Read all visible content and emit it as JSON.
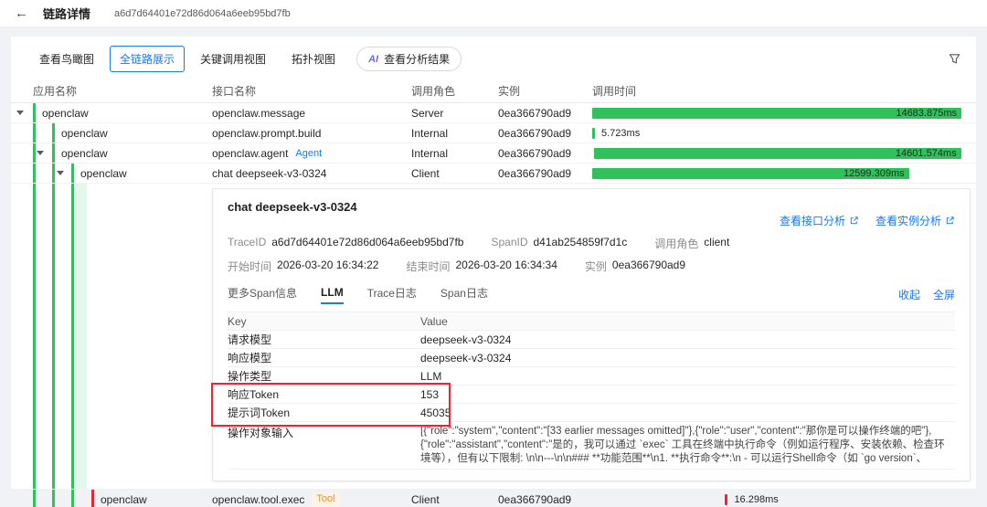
{
  "icons": {
    "back": "←",
    "ai": "AI",
    "external_link": "external-link",
    "filter": "funnel",
    "caret": "caret-down"
  },
  "colors": {
    "green": "#2fc25b",
    "red": "#f5222d",
    "blue": "#1677ff"
  },
  "page": {
    "title": "链路详情",
    "trace_id": "a6d7d64401e72d86d064a6eeb95bd7fb"
  },
  "toolbar": {
    "tabs": [
      {
        "label": "查看鸟瞰图"
      },
      {
        "label": "全链路展示"
      },
      {
        "label": "关键调用视图"
      },
      {
        "label": "拓扑视图"
      }
    ],
    "ai_button_label": "查看分析结果"
  },
  "table": {
    "columns": [
      "应用名称",
      "接口名称",
      "调用角色",
      "实例",
      "调用时间"
    ],
    "rows": [
      {
        "app": "openclaw",
        "interface": "openclaw.message",
        "tag": "",
        "role": "Server",
        "instance": "0ea366790ad9",
        "duration": "14683.875ms",
        "bar_width_pct": 100,
        "bar_offset_pct": 0,
        "bar_color": "#2fc25b"
      },
      {
        "app": "openclaw",
        "interface": "openclaw.prompt.build",
        "tag": "",
        "role": "Internal",
        "instance": "0ea366790ad9",
        "duration": "5.723ms",
        "bar_width_pct": 0.4,
        "bar_offset_pct": 0,
        "bar_color": "#2fc25b"
      },
      {
        "app": "openclaw",
        "interface": "openclaw.agent",
        "tag": "Agent",
        "role": "Internal",
        "instance": "0ea366790ad9",
        "duration": "14601.574ms",
        "bar_width_pct": 99.3,
        "bar_offset_pct": 0.6,
        "bar_color": "#2fc25b"
      },
      {
        "app": "openclaw",
        "interface": "chat deepseek-v3-0324",
        "tag": "",
        "role": "Client",
        "instance": "0ea366790ad9",
        "duration": "12599.309ms",
        "bar_width_pct": 85.8,
        "bar_offset_pct": 0,
        "bar_color": "#2fc25b"
      },
      {
        "app": "openclaw",
        "interface": "openclaw.tool.exec",
        "tag": "Tool",
        "role": "Client",
        "instance": "0ea366790ad9",
        "duration": "16.298ms",
        "bar_width_pct": 0.4,
        "bar_offset_pct": 36,
        "bar_color": "#f5222d"
      }
    ]
  },
  "detail": {
    "title": "chat deepseek-v3-0324",
    "links": [
      {
        "label": "查看接口分析"
      },
      {
        "label": "查看实例分析"
      }
    ],
    "meta_row1": [
      {
        "label": "TraceID",
        "value": "a6d7d64401e72d86d064a6eeb95bd7fb"
      },
      {
        "label": "SpanID",
        "value": "d41ab254859f7d1c"
      },
      {
        "label": "调用角色",
        "value": "client"
      }
    ],
    "meta_row2": [
      {
        "label": "开始时间",
        "value": "2026-03-20 16:34:22"
      },
      {
        "label": "结束时间",
        "value": "2026-03-20 16:34:34"
      },
      {
        "label": "实例",
        "value": "0ea366790ad9"
      }
    ],
    "tabs": [
      {
        "label": "更多Span信息"
      },
      {
        "label": "LLM"
      },
      {
        "label": "Trace日志"
      },
      {
        "label": "Span日志"
      }
    ],
    "actions": [
      {
        "label": "收起"
      },
      {
        "label": "全屏"
      }
    ],
    "kv": {
      "headers": [
        "Key",
        "Value"
      ],
      "rows": [
        {
          "key": "请求模型",
          "value": "deepseek-v3-0324"
        },
        {
          "key": "响应模型",
          "value": "deepseek-v3-0324"
        },
        {
          "key": "操作类型",
          "value": "LLM"
        },
        {
          "key": "响应Token",
          "value": "153"
        },
        {
          "key": "提示词Token",
          "value": "45035"
        },
        {
          "key": "操作对象输入",
          "value": "[{\"role\":\"system\",\"content\":\"[33 earlier messages omitted]\"},{\"role\":\"user\",\"content\":\"那你是可以操作终端的吧\"},{\"role\":\"assistant\",\"content\":\"是的，我可以通过 `exec` 工具在终端中执行命令（例如运行程序、安装依赖、检查环境等），但有以下限制: \\n\\n---\\n\\n### **功能范围**\\n1. **执行命令**:\\n  - 可以运行Shell命令（如 `go version`、`python --version`）。\\n  - 示例: 编译和运行Go程序、安装工具、检查进程等。\\n\\n2. **文件操作**:\\n  - 结合 `exec` 和文..."
        }
      ]
    }
  }
}
